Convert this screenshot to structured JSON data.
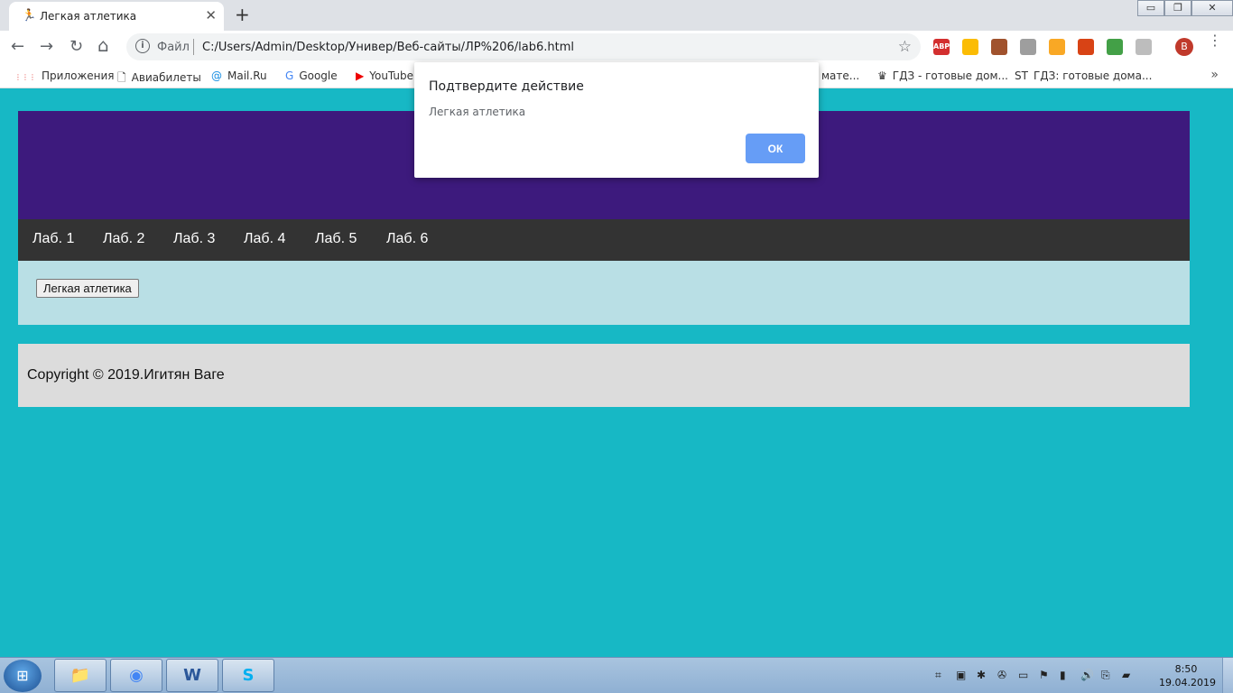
{
  "browser": {
    "tab_title": "Легкая атлетика",
    "tab_favicon": "🏃",
    "tab_close": "✕",
    "new_tab": "+",
    "win_min": "▭",
    "win_restore": "❐",
    "win_close": "✕",
    "back": "←",
    "forward": "→",
    "reload": "↻",
    "home": "⌂",
    "info": "i",
    "file_label": "Файл",
    "url": "C:/Users/Admin/Desktop/Универ/Веб-сайты/ЛР%206/lab6.html",
    "star": "☆",
    "extensions": [
      {
        "name": "abp-icon",
        "label": "ABP",
        "color": "#d32f2f"
      },
      {
        "name": "speed-dial-icon",
        "label": "",
        "color": "#fbbc04"
      },
      {
        "name": "pdf-icon",
        "label": "",
        "color": "#a0522d"
      },
      {
        "name": "gear-extension-icon",
        "label": "",
        "color": "#9e9e9e"
      },
      {
        "name": "bookmark-ext-icon",
        "label": "",
        "color": "#f9a825"
      },
      {
        "name": "office-icon",
        "label": "",
        "color": "#d84315"
      },
      {
        "name": "pinwheel-icon",
        "label": "",
        "color": "#43a047"
      },
      {
        "name": "puzzle-icon",
        "label": "",
        "color": "#bdbdbd"
      }
    ],
    "avatar_letter": "В",
    "menu": "⋮"
  },
  "bookmarks": [
    {
      "name": "apps",
      "icon": "⋮⋮⋮",
      "label": "Приложения"
    },
    {
      "name": "aviabilety",
      "icon": "🗋",
      "label": "Авиабилеты"
    },
    {
      "name": "mailru",
      "icon": "@",
      "label": "Mail.Ru"
    },
    {
      "name": "google",
      "icon": "G",
      "label": "Google"
    },
    {
      "name": "youtube",
      "icon": "▶",
      "label": "YouTube"
    },
    {
      "name": "mate",
      "icon": "",
      "label": "мате..."
    },
    {
      "name": "gdz1",
      "icon": "♛",
      "label": "ГДЗ - готовые дом..."
    },
    {
      "name": "gdz2",
      "icon": "ST",
      "label": "ГДЗ: готовые дома..."
    }
  ],
  "bookmarks_more": "»",
  "page": {
    "nav": [
      "Лаб. 1",
      "Лаб. 2",
      "Лаб. 3",
      "Лаб. 4",
      "Лаб. 5",
      "Лаб. 6"
    ],
    "button_label": "Легкая атлетика",
    "copyright": "Copyright © 2019.Игитян Ваге",
    "colors": {
      "header": "#3d1a7d",
      "navbar": "#333333",
      "content": "#b9dfe5",
      "footer": "#dcdcdc",
      "background": "#17b8c5"
    }
  },
  "dialog": {
    "title": "Подтвердите действие",
    "message": "Легкая атлетика",
    "ok_label": "ОК"
  },
  "taskbar": {
    "start": "⊞",
    "apps": [
      {
        "name": "explorer-icon",
        "glyph": "📁"
      },
      {
        "name": "chrome-icon",
        "glyph": "◉"
      },
      {
        "name": "word-icon",
        "glyph": "W"
      },
      {
        "name": "skype-icon",
        "glyph": "S"
      }
    ],
    "tray": [
      "⌗",
      "▣",
      "✱",
      "✇",
      "▭",
      "⚑",
      "▮",
      "🔊",
      "⎘",
      "▰"
    ],
    "time": "8:50",
    "date": "19.04.2019"
  }
}
